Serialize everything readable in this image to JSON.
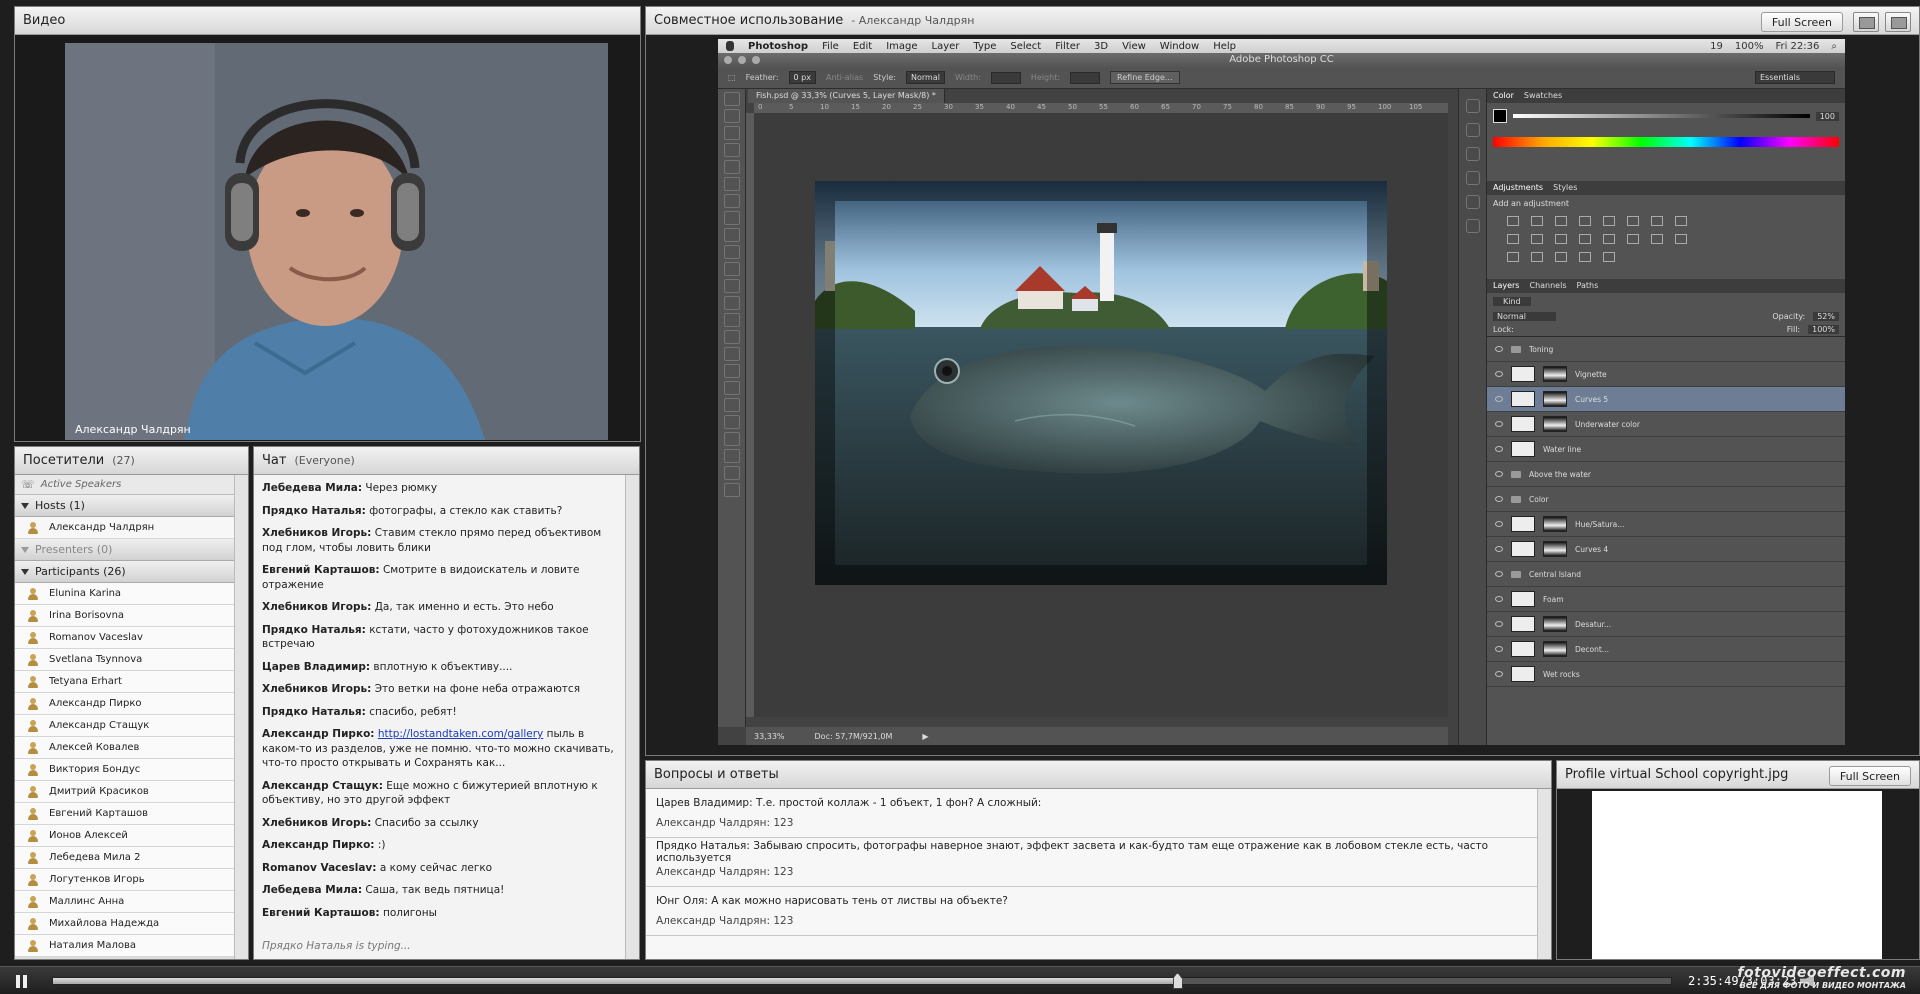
{
  "video": {
    "title": "Видео",
    "camera_name": "Александр Чалдрян"
  },
  "share": {
    "title": "Совместное использование",
    "presenter": "- Александр Чалдрян",
    "fullscreen_label": "Full Screen"
  },
  "photoshop": {
    "mac_menu": [
      "Photoshop",
      "File",
      "Edit",
      "Image",
      "Layer",
      "Type",
      "Select",
      "Filter",
      "3D",
      "View",
      "Window",
      "Help"
    ],
    "mac_status": [
      "19",
      "100%",
      "Fri 22:36"
    ],
    "window_title": "Adobe Photoshop CC",
    "options": {
      "feather_label": "Feather:",
      "feather_value": "0 px",
      "antialias": "Anti-alias",
      "style_label": "Style:",
      "style_value": "Normal",
      "width_label": "Width:",
      "height_label": "Height:",
      "refine_edge": "Refine Edge...",
      "workspace": "Essentials"
    },
    "doc_tab": "Fish.psd @ 33,3% (Curves 5, Layer Mask/8) *",
    "ruler_ticks": [
      "0",
      "5",
      "10",
      "15",
      "20",
      "25",
      "30",
      "35",
      "40",
      "45",
      "50",
      "55",
      "60",
      "65",
      "70",
      "75",
      "80",
      "85",
      "90",
      "95",
      "100",
      "105"
    ],
    "status_zoom": "33,33%",
    "status_doc": "Doc: 57,7M/921,0M",
    "color_tabs": [
      "Color",
      "Swatches"
    ],
    "k_value": "100",
    "adj_tabs": [
      "Adjustments",
      "Styles"
    ],
    "add_adjustment": "Add an adjustment",
    "layers_tabs": [
      "Layers",
      "Channels",
      "Paths"
    ],
    "kind_label": "Kind",
    "blend_mode": "Normal",
    "opacity_label": "Opacity:",
    "opacity_value": "52%",
    "lock_label": "Lock:",
    "fill_label": "Fill:",
    "fill_value": "100%",
    "layers": [
      {
        "name": "Toning",
        "type": "folder"
      },
      {
        "name": "Vignette",
        "type": "adj"
      },
      {
        "name": "Curves 5",
        "type": "adj",
        "selected": true
      },
      {
        "name": "Underwater color",
        "type": "adj"
      },
      {
        "name": "Water line",
        "type": "layer"
      },
      {
        "name": "Above the water",
        "type": "folder"
      },
      {
        "name": "Color",
        "type": "folder"
      },
      {
        "name": "Hue/Satura...",
        "type": "adj"
      },
      {
        "name": "Curves 4",
        "type": "adj"
      },
      {
        "name": "Central Island",
        "type": "folder"
      },
      {
        "name": "Foam",
        "type": "layer"
      },
      {
        "name": "Desatur...",
        "type": "adj"
      },
      {
        "name": "Decont...",
        "type": "adj"
      },
      {
        "name": "Wet rocks",
        "type": "layer"
      }
    ]
  },
  "attendees": {
    "title": "Посетители",
    "count": "(27)",
    "active_speakers": "Active Speakers",
    "hosts_label": "Hosts (1)",
    "host_name": "Александр Чалдрян",
    "presenters_label": "Presenters (0)",
    "participants_label": "Participants (26)",
    "participants": [
      "Elunina Karina",
      "Irina Borisovna",
      "Romanov Vaceslav",
      "Svetlana Tsynnova",
      "Tetyana Erhart",
      "Александр Пирко",
      "Александр Стащук",
      "Алексей Ковалев",
      "Виктория Бондус",
      "Дмитрий Красиков",
      "Евгений Карташов",
      "Ионов Алексей",
      "Лебедева Мила 2",
      "Логутенков Игорь",
      "Маллинс Анна",
      "Михайлова Надежда",
      "Наталия Малова"
    ]
  },
  "chat": {
    "title": "Чат",
    "scope": "(Everyone)",
    "messages": [
      {
        "author": "Лебедева Мила:",
        "text": "Через рюмку"
      },
      {
        "author": "Прядко Наталья:",
        "text": "фотографы, а стекло как ставить?"
      },
      {
        "author": "Хлебников Игорь:",
        "text": "Ставим стекло прямо перед объективом под глом, чтобы ловить блики"
      },
      {
        "author": "Евгений Карташов:",
        "text": "Смотрите в видоискатель и ловите отражение"
      },
      {
        "author": "Хлебников Игорь:",
        "text": "Да, так именно и есть. Это небо"
      },
      {
        "author": "Прядко Наталья:",
        "text": "кстати, часто у фотохудожников такое встречаю"
      },
      {
        "author": "Царев Владимир:",
        "text": "вплотную к объективу...."
      },
      {
        "author": "Хлебников Игорь:",
        "text": "Это ветки на фоне неба отражаются"
      },
      {
        "author": "Прядко Наталья:",
        "text": "спасибо, ребят!"
      },
      {
        "author": "Александр Пирко:",
        "link": "http://lostandtaken.com/gallery",
        "text": "пыль в каком-то из разделов, уже не помню. что-то можно скачивать, что-то просто открывать и Сохранять как..."
      },
      {
        "author": "Александр Стащук:",
        "text": "Еще можно с бижутерией вплотную к объективу, но это другой эффект"
      },
      {
        "author": "Хлебников Игорь:",
        "text": "Спасибо за ссылку"
      },
      {
        "author": "Александр Пирко:",
        "text": ":)"
      },
      {
        "author": "Romanov Vaceslav:",
        "text": "а кому сейчас легко"
      },
      {
        "author": "Лебедева Мила:",
        "text": "Саша, так ведь пятница!"
      },
      {
        "author": "Евгений Карташов:",
        "text": "полигоны"
      }
    ],
    "typing": "Прядко Наталья is typing..."
  },
  "qa": {
    "title": "Вопросы и ответы",
    "items": [
      {
        "q": "Царев Владимир: Т.е. простой коллаж - 1 объект, 1 фон? А сложный:",
        "a": "Александр Чалдрян: 123"
      },
      {
        "q": "Прядко Наталья: Забываю спросить, фотографы наверное знают, эффект засвета и как-будто там еще отражение как в лобовом стекле есть, часто используется",
        "a": "Александр Чалдрян: 123"
      },
      {
        "q": "Юнг Оля: А как можно нарисовать тень от листвы на объекте?",
        "a": "Александр Чалдрян: 123"
      }
    ]
  },
  "profile": {
    "title": "Profile virtual School copyright.jpg",
    "fullscreen_label": "Full Screen"
  },
  "playbar": {
    "time": "2:35:49/3:03:23",
    "progress": 0.695
  },
  "watermark": {
    "line1": "fotovideoeffect.com",
    "line2": "ВСЁ ДЛЯ ФОТО И ВИДЕО МОНТАЖА"
  }
}
